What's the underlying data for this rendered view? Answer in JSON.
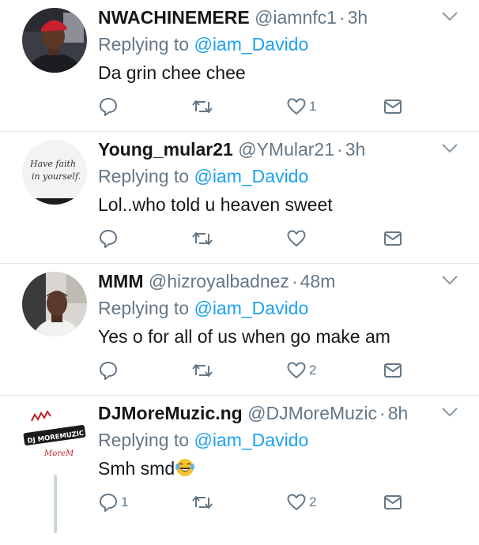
{
  "tweets": [
    {
      "name": "NWACHINEMERE",
      "handle": "@iamnfc1",
      "time": "3h",
      "reply_prefix": "Replying to",
      "reply_to": "@iam_Davido",
      "text": "Da grin chee chee",
      "reply_count": "",
      "like_count": "1"
    },
    {
      "name": "Young_mular21",
      "handle": "@YMular21",
      "time": "3h",
      "reply_prefix": "Replying to",
      "reply_to": "@iam_Davido",
      "text": "Lol..who told u heaven sweet",
      "reply_count": "",
      "like_count": "",
      "avatar_text": [
        "Have faith",
        "in yourself."
      ]
    },
    {
      "name": "MMM",
      "handle": "@hizroyalbadnez",
      "time": "48m",
      "reply_prefix": "Replying to",
      "reply_to": "@iam_Davido",
      "text": "Yes o for all of us when go make am",
      "reply_count": "",
      "like_count": "2"
    },
    {
      "name": "DJMoreMuzic.ng",
      "handle": "@DJMoreMuzic",
      "time": "8h",
      "reply_prefix": "Replying to",
      "reply_to": "@iam_Davido",
      "text": "Smh smd",
      "reply_count": "1",
      "like_count": "2",
      "avatar_text": [
        "DJ MOREMUZIC",
        "MoreM"
      ]
    }
  ],
  "icons": {
    "reply": "reply-icon",
    "retweet": "retweet-icon",
    "like": "heart-icon",
    "dm": "envelope-icon",
    "more": "chevron-down-icon",
    "emoji": "laughing-tears-emoji"
  },
  "colors": {
    "link": "#1da1f2",
    "muted": "#657786",
    "text": "#14171a",
    "divider": "#e1e8ed"
  }
}
